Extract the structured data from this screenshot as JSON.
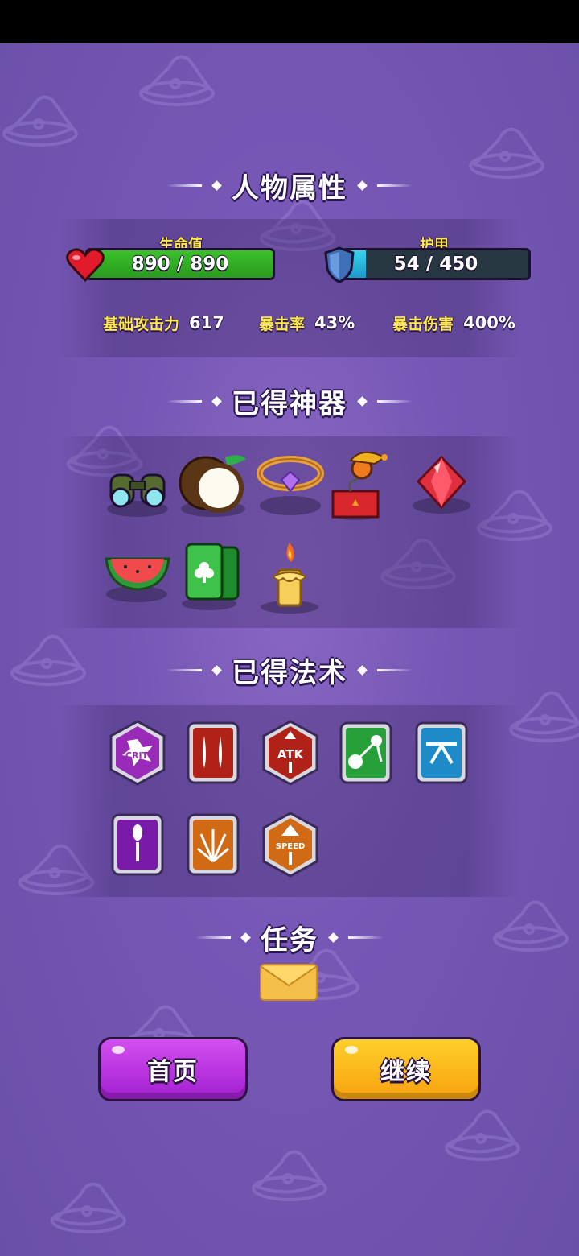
{
  "sections": {
    "attributes_title": "人物属性",
    "artifacts_title": "已得神器",
    "spells_title": "已得法术",
    "tasks_title": "任务"
  },
  "health": {
    "label": "生命值",
    "text": "890 / 890",
    "current": 890,
    "max": 890,
    "color": "#3bc12a"
  },
  "armor": {
    "label": "护甲",
    "text": "54 / 450",
    "current": 54,
    "max": 450,
    "color": "#39d3f0"
  },
  "stats": [
    {
      "label": "基础攻击力",
      "value": "617"
    },
    {
      "label": "暴击率",
      "value": "43%"
    },
    {
      "label": "暴击伤害",
      "value": "400%"
    }
  ],
  "artifacts": [
    "binoculars-icon",
    "coconut-icon",
    "gem-bracelet-icon",
    "jack-in-the-box-icon",
    "ruby-icon",
    "watermelon-icon",
    "clover-card-icon",
    "candle-icon"
  ],
  "spells": [
    {
      "icon": "crit-spell-icon",
      "text": "CRIT"
    },
    {
      "icon": "double-claw-spell-icon"
    },
    {
      "icon": "atk-up-spell-icon",
      "text": "ATK"
    },
    {
      "icon": "bounce-skull-spell-icon"
    },
    {
      "icon": "split-shot-spell-icon"
    },
    {
      "icon": "piercing-shot-spell-icon"
    },
    {
      "icon": "spread-shot-spell-icon"
    },
    {
      "icon": "speed-up-spell-icon",
      "text": "SPEED"
    }
  ],
  "buttons": {
    "home": "首页",
    "continue": "继续"
  }
}
